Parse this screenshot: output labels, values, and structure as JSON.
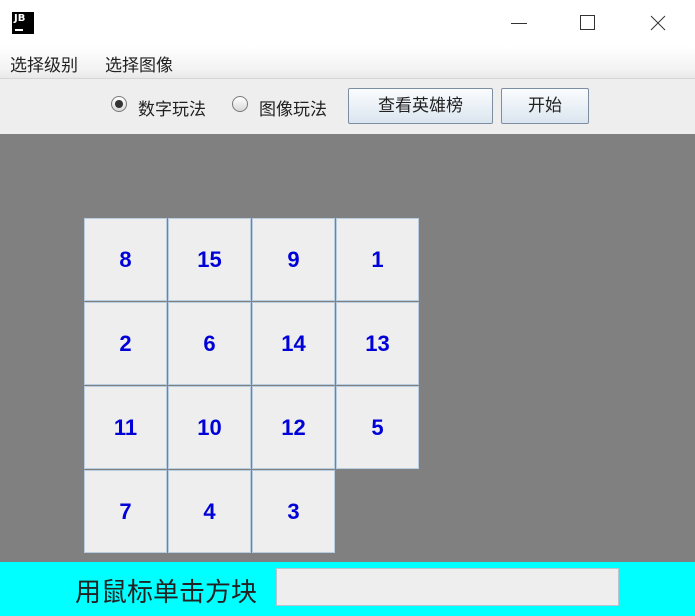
{
  "window": {
    "icon_text": "JB"
  },
  "menu": {
    "items": [
      "选择级别",
      "选择图像"
    ]
  },
  "toolbar": {
    "radios": [
      {
        "label": "数字玩法",
        "selected": true
      },
      {
        "label": "图像玩法",
        "selected": false
      }
    ],
    "leaderboard_label": "查看英雄榜",
    "start_label": "开始"
  },
  "board": {
    "tiles": [
      [
        "8",
        "15",
        "9",
        "1"
      ],
      [
        "2",
        "6",
        "14",
        "13"
      ],
      [
        "11",
        "10",
        "12",
        "5"
      ],
      [
        "7",
        "4",
        "3",
        ""
      ]
    ]
  },
  "status": {
    "label": "用鼠标单击方块",
    "field_value": ""
  },
  "colors": {
    "board_bg": "#808080",
    "tile_text": "#0000d8",
    "status_bg": "#00ffff"
  }
}
